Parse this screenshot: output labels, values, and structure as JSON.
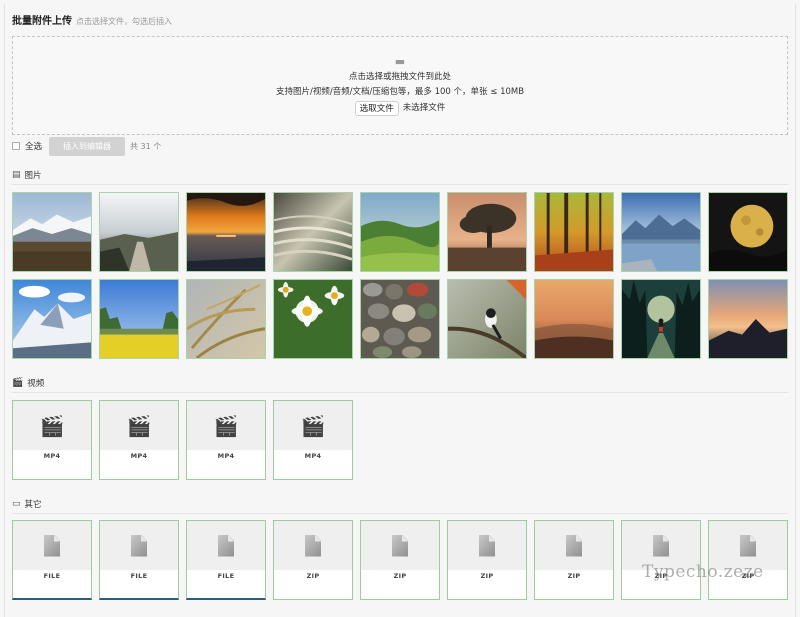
{
  "header": {
    "title": "批量附件上传",
    "hint": "点击选择文件，勾选后插入"
  },
  "dropzone": {
    "folder_icon": "folder-icon",
    "line1": "点击选择或拖拽文件到此处",
    "line2": "支持图片/视频/音频/文档/压缩包等，最多 100 个，单张 ≤ 10MB",
    "choose_button": "选取文件",
    "no_file_text": "未选择文件"
  },
  "actions": {
    "select_all": "全选",
    "insert_button": "插入到编辑器",
    "count": "共 31 个"
  },
  "sections": {
    "images": {
      "title": "图片",
      "icon": "image-icon"
    },
    "videos": {
      "title": "视频",
      "icon": "clapperboard-icon"
    },
    "others": {
      "title": "其它",
      "icon": "document-icon"
    }
  },
  "images": [
    {
      "name": "snowy-mountain-plain"
    },
    {
      "name": "foggy-forest-path"
    },
    {
      "name": "sea-sunset"
    },
    {
      "name": "rice-terraces"
    },
    {
      "name": "green-hills"
    },
    {
      "name": "lone-tree"
    },
    {
      "name": "autumn-forest"
    },
    {
      "name": "mountain-lake"
    },
    {
      "name": "full-moon"
    },
    {
      "name": "snowy-peak"
    },
    {
      "name": "rapeseed-field"
    },
    {
      "name": "wheat-ears"
    },
    {
      "name": "daisies"
    },
    {
      "name": "pebbles"
    },
    {
      "name": "bird-on-branch"
    },
    {
      "name": "misty-hills"
    },
    {
      "name": "night-forest-walker"
    },
    {
      "name": "sunset-mountain"
    }
  ],
  "videos": [
    {
      "label": "MP4"
    },
    {
      "label": "MP4"
    },
    {
      "label": "MP4"
    },
    {
      "label": "MP4"
    }
  ],
  "others": [
    {
      "label": "FILE"
    },
    {
      "label": "FILE"
    },
    {
      "label": "FILE"
    },
    {
      "label": "ZIP"
    },
    {
      "label": "ZIP"
    },
    {
      "label": "ZIP"
    },
    {
      "label": "ZIP"
    },
    {
      "label": "ZIP"
    },
    {
      "label": "ZIP"
    }
  ],
  "watermark": "Typecho.zeze",
  "colors": {
    "card_border": "#9ccc9c",
    "insert_button_bg": "#d2d2d2",
    "selected_bottom": "#2e5d78"
  }
}
